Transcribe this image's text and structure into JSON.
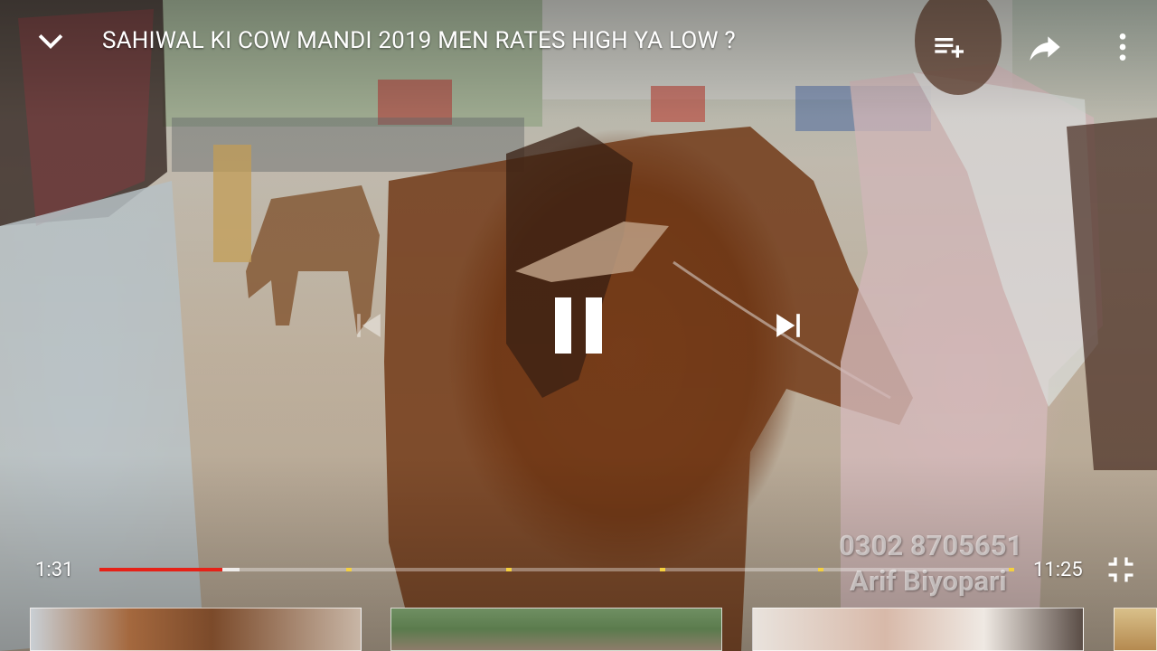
{
  "video": {
    "title": "SAHIWAL KI COW MANDI 2019 MEN RATES HIGH YA LOW ?",
    "watermark_phone": "0302 8705651",
    "watermark_name": "Arif Biyopari"
  },
  "top_bar": {
    "minimize_icon": "chevron-down",
    "add_to_playlist_icon": "playlist-add",
    "share_icon": "share-arrow",
    "more_icon": "more-vertical"
  },
  "center_controls": {
    "previous_icon": "skip-previous",
    "play_pause_icon": "pause",
    "next_icon": "skip-next"
  },
  "progress": {
    "current_time": "1:31",
    "duration": "11:25",
    "played_fraction": 0.134,
    "buffered_fraction": 0.153,
    "ad_markers_fraction": [
      0.27,
      0.445,
      0.613,
      0.786,
      0.995
    ],
    "played_color": "#e62117",
    "marker_color": "#f4d03f"
  },
  "fullscreen_exit_icon": "fullscreen-exit",
  "thumbnails": [
    "related-video-1",
    "related-video-2",
    "related-video-3",
    "related-video-4"
  ]
}
